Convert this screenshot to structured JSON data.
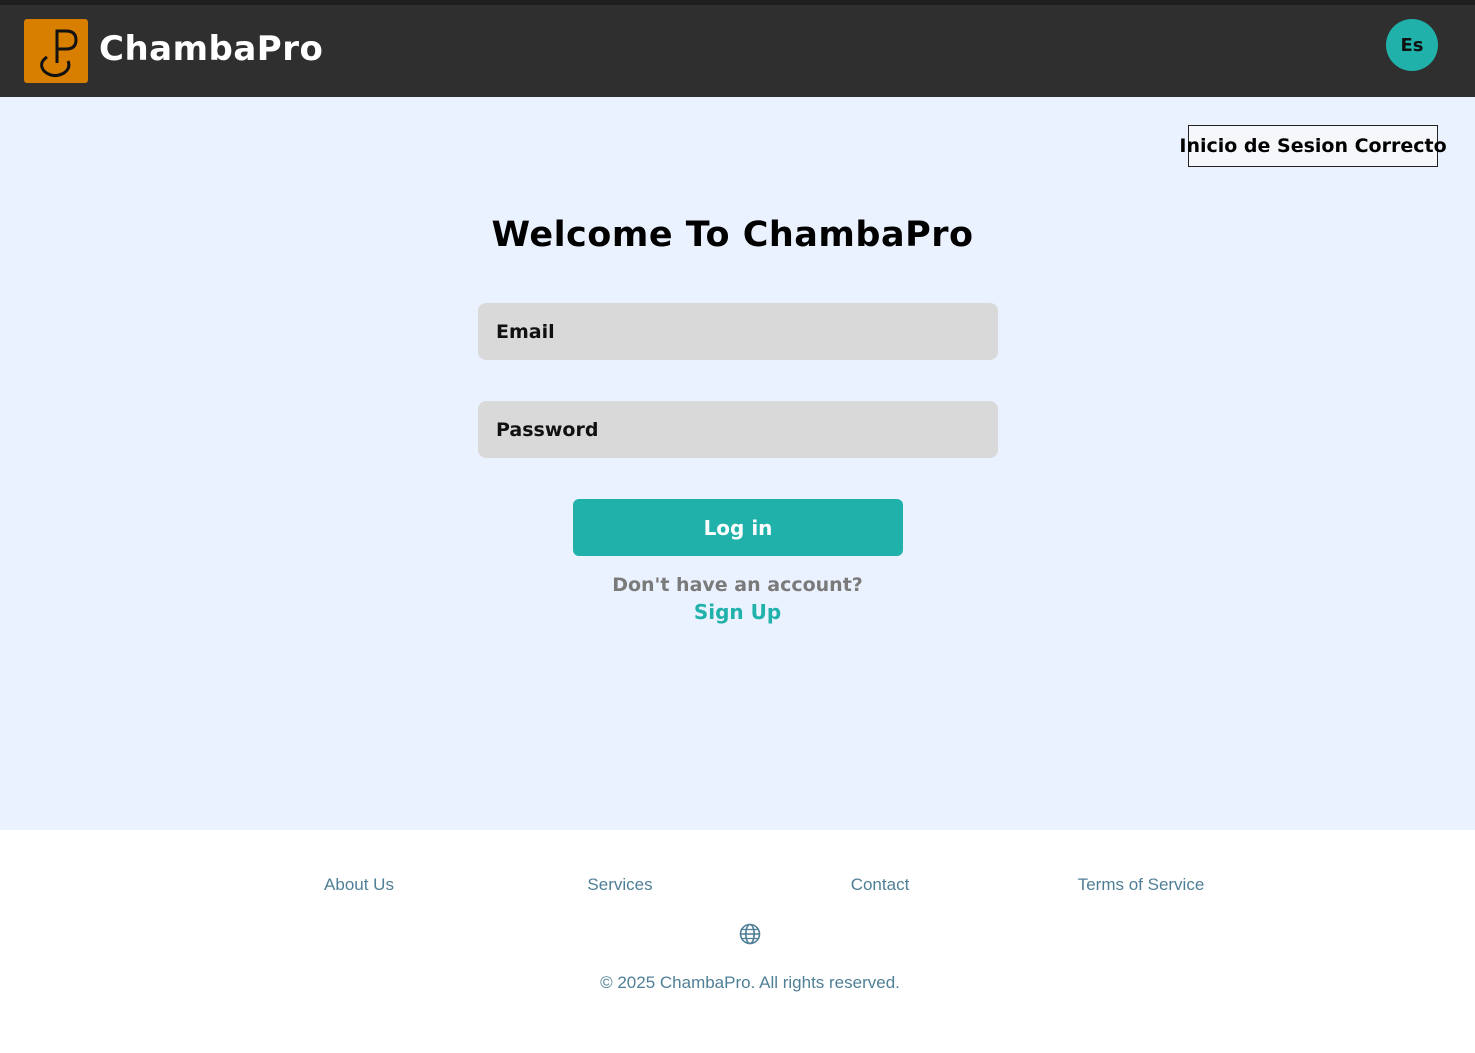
{
  "header": {
    "brand": "ChambaPro",
    "logo_letter": "P",
    "language_button": "Es"
  },
  "notification": {
    "text": "Inicio de Sesion Correcto"
  },
  "login": {
    "title": "Welcome To ChambaPro",
    "email_placeholder": "Email",
    "email_value": "",
    "password_placeholder": "Password",
    "password_value": "",
    "submit_label": "Log in",
    "no_account_text": "Don't have an account?",
    "signup_link": "Sign Up"
  },
  "footer": {
    "links": [
      "About Us",
      "Services",
      "Contact",
      "Terms of Service"
    ],
    "globe_icon": "globe-icon",
    "copyright": "© 2025 ChambaPro. All rights reserved."
  },
  "colors": {
    "accent": "#20b2aa",
    "navbar": "#2f2f2f",
    "logo_bg": "#d97f00",
    "page_bg": "#ebf2ff",
    "input_bg": "#d9d9d9",
    "footer_text": "#4f7f96"
  }
}
